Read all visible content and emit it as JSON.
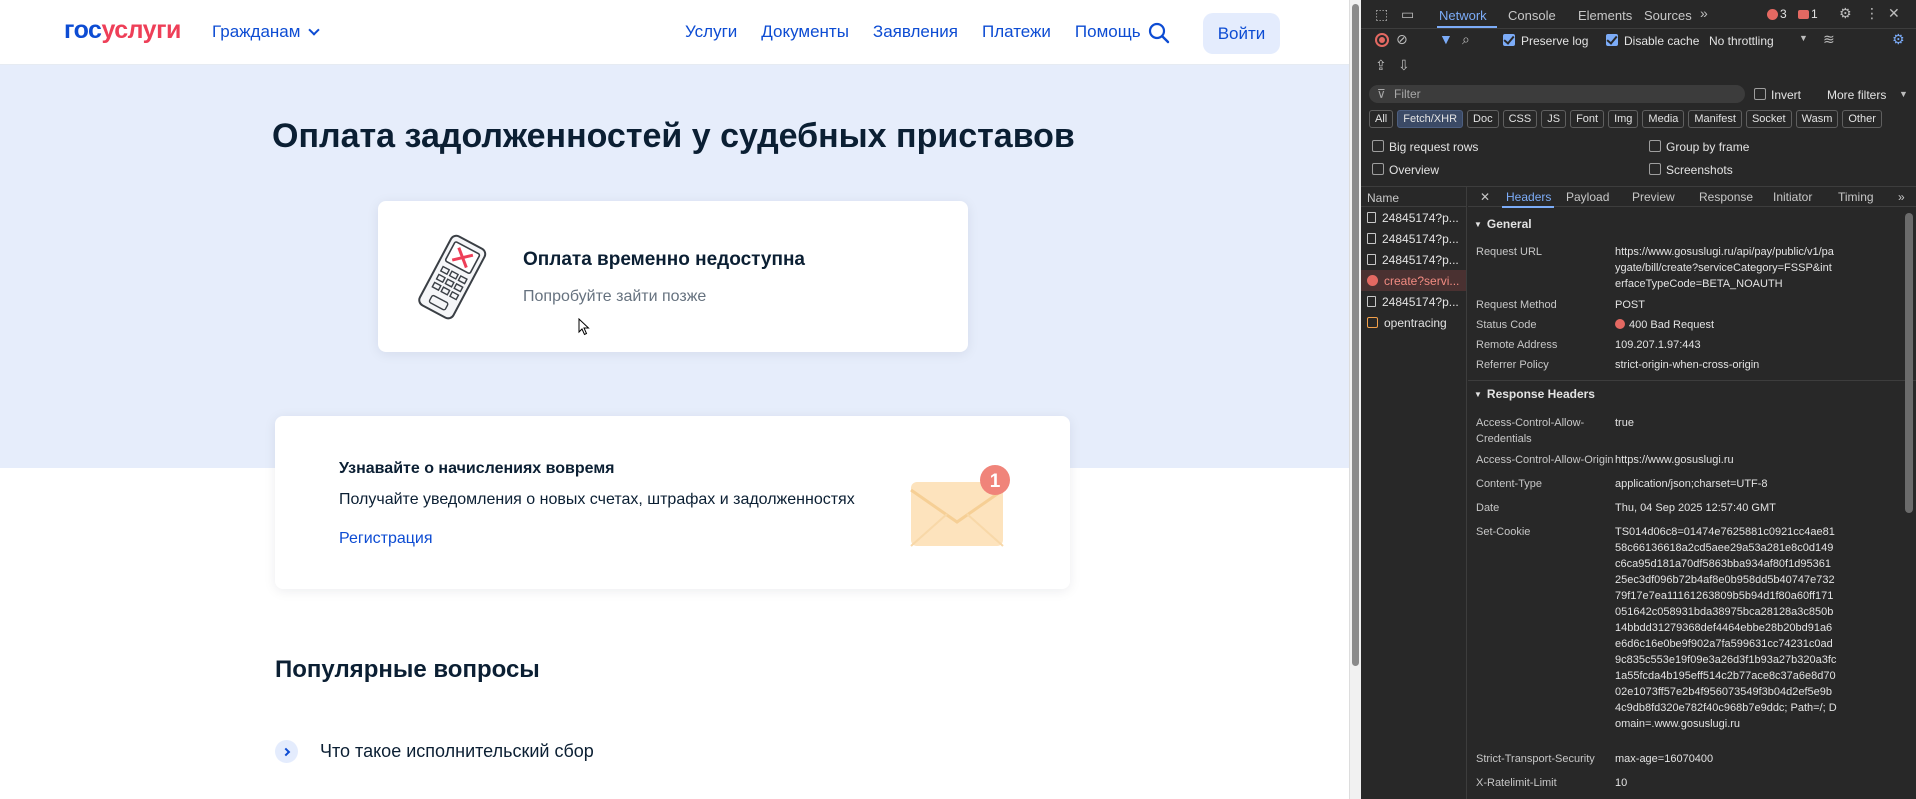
{
  "site": {
    "logo": {
      "part1": "гос",
      "part2": "услуги"
    },
    "citizens_menu": "Гражданам",
    "nav": [
      "Услуги",
      "Документы",
      "Заявления",
      "Платежи",
      "Помощь"
    ],
    "login": "Войти",
    "page_title": "Оплата задолженностей у судебных приставов",
    "unavailable": {
      "title": "Оплата временно недоступна",
      "subtitle": "Попробуйте зайти позже"
    },
    "notify": {
      "title": "Узнавайте о начислениях вовремя",
      "subtitle": "Получайте уведомления о новых счетах, штрафах и задолженностях",
      "link": "Регистрация",
      "badge": "1"
    },
    "faq_title": "Популярные вопросы",
    "faq_items": [
      "Что такое исполнительский сбор"
    ]
  },
  "devtools": {
    "tabs": [
      "Network",
      "Console",
      "Elements",
      "Sources"
    ],
    "errors": "3",
    "warnings": "1",
    "toolbar": {
      "preserve_log": "Preserve log",
      "disable_cache": "Disable cache",
      "throttling": "No throttling"
    },
    "filter_placeholder": "Filter",
    "invert": "Invert",
    "more_filters": "More filters",
    "chips": [
      "All",
      "Fetch/XHR",
      "Doc",
      "CSS",
      "JS",
      "Font",
      "Img",
      "Media",
      "Manifest",
      "Socket",
      "Wasm",
      "Other"
    ],
    "options": {
      "big_rows": "Big request rows",
      "group_by_frame": "Group by frame",
      "overview": "Overview",
      "screenshots": "Screenshots"
    },
    "name_header": "Name",
    "requests": [
      {
        "name": "24845174?p...",
        "type": "file"
      },
      {
        "name": "24845174?p...",
        "type": "file"
      },
      {
        "name": "24845174?p...",
        "type": "file"
      },
      {
        "name": "create?servi...",
        "type": "error"
      },
      {
        "name": "24845174?p...",
        "type": "file"
      },
      {
        "name": "opentracing",
        "type": "trace"
      }
    ],
    "detail_tabs": [
      "Headers",
      "Payload",
      "Preview",
      "Response",
      "Initiator",
      "Timing"
    ],
    "general_label": "General",
    "general": [
      {
        "k": "Request URL",
        "v": "https://www.gosuslugi.ru/api/pay/public/v1/paygate/bill/create?serviceCategory=FSSP&interfaceTypeCode=BETA_NOAUTH"
      },
      {
        "k": "Request Method",
        "v": "POST"
      },
      {
        "k": "Status Code",
        "v": "400 Bad Request"
      },
      {
        "k": "Remote Address",
        "v": "109.207.1.97:443"
      },
      {
        "k": "Referrer Policy",
        "v": "strict-origin-when-cross-origin"
      }
    ],
    "response_label": "Response Headers",
    "response": [
      {
        "k": "Access-Control-Allow-Credentials",
        "v": "true"
      },
      {
        "k": "Access-Control-Allow-Origin",
        "v": "https://www.gosuslugi.ru"
      },
      {
        "k": "Content-Type",
        "v": "application/json;charset=UTF-8"
      },
      {
        "k": "Date",
        "v": "Thu, 04 Sep 2025 12:57:40 GMT"
      },
      {
        "k": "Set-Cookie",
        "v": "TS014d06c8=01474e7625881c0921cc4ae8158c66136618a2cd5aee29a53a281e8c0d149c6ca95d181a70df5863bba934af80f1d9536125ec3df096b72b4af8e0b958dd5b40747e73279f17e7ea11161263809b5b94d1f80a60ff171051642c058931bda38975bca28128a3c850b14bbdd31279368def4464ebbe28b20bd91a6e6d6c16e0be9f902a7fa599631cc74231c0ad9c835c553e19f09e3a26d3f1b93a27b320a3fc1a55fcda4b195eff514c2b77ace8c37a6e8d7002e1073ff57e2b4f956073549f3b04d2ef5e9b4c9db8fd320e782f40c968b7e9ddc; Path=/; Domain=.www.gosuslugi.ru"
      },
      {
        "k": "Strict-Transport-Security",
        "v": "max-age=16070400"
      },
      {
        "k": "X-Ratelimit-Limit",
        "v": "10"
      }
    ]
  }
}
